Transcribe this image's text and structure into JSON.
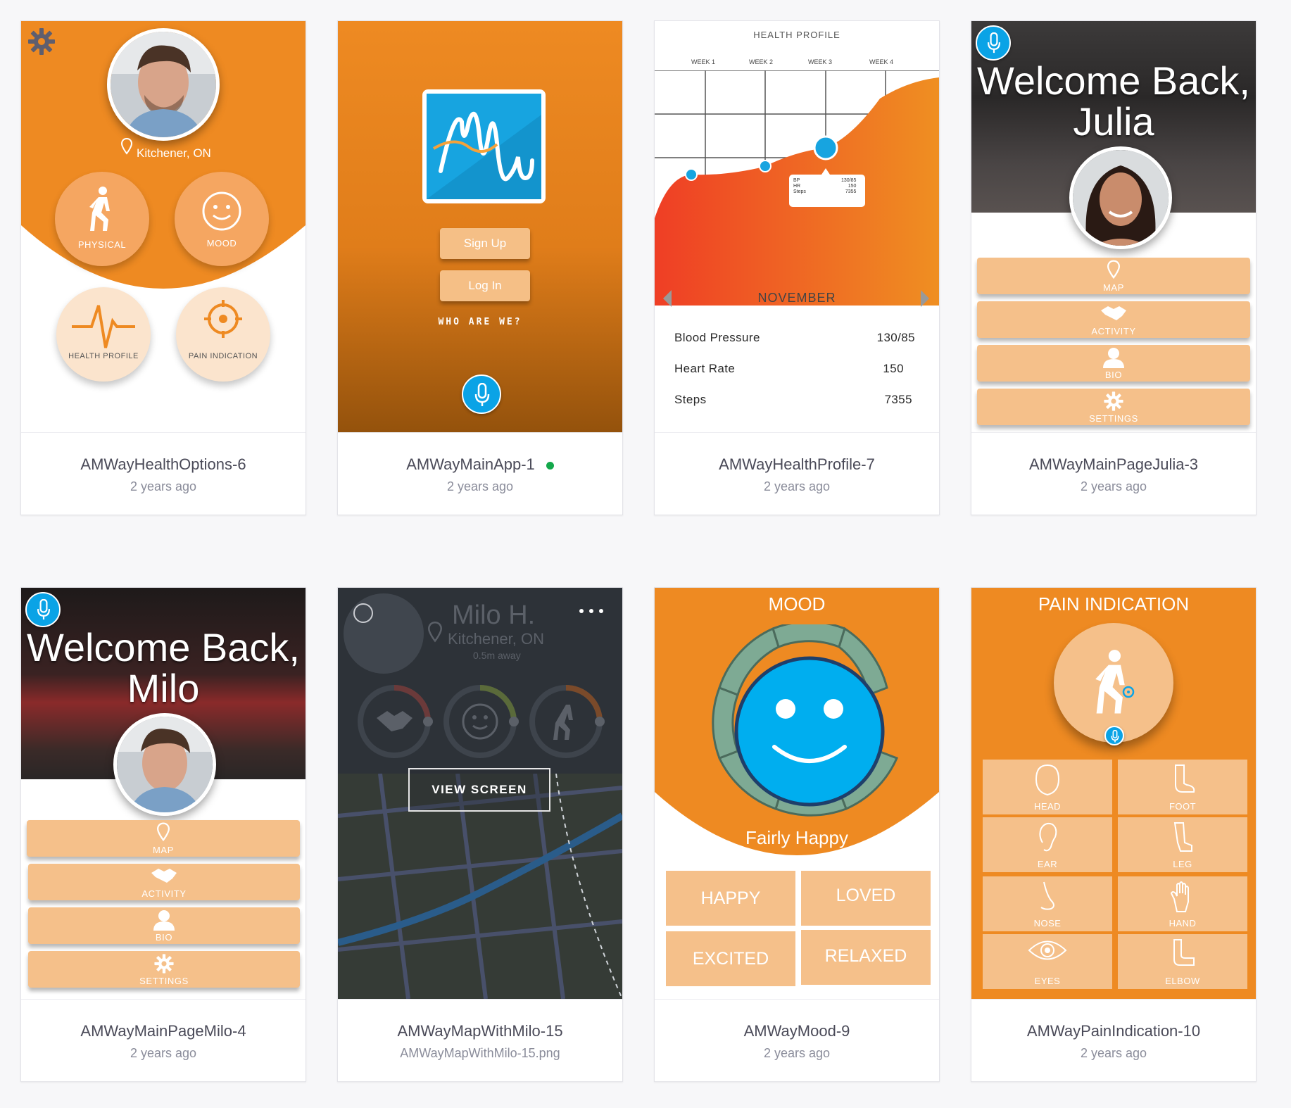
{
  "cards": [
    {
      "title": "AMWayHealthOptions-6",
      "subtitle": "2 years ago"
    },
    {
      "title": "AMWayMainApp-1",
      "subtitle": "2 years ago"
    },
    {
      "title": "AMWayHealthProfile-7",
      "subtitle": "2 years ago"
    },
    {
      "title": "AMWayMainPageJulia-3",
      "subtitle": "2 years ago"
    },
    {
      "title": "AMWayMainPageMilo-4",
      "subtitle": "2 years ago"
    },
    {
      "title": "AMWayMapWithMilo-15",
      "subtitle": "AMWayMapWithMilo-15.png"
    },
    {
      "title": "AMWayMood-9",
      "subtitle": "2 years ago"
    },
    {
      "title": "AMWayPainIndication-10",
      "subtitle": "2 years ago"
    }
  ],
  "health_options": {
    "location": "Kitchener, ON",
    "options": [
      "PHYSICAL",
      "MOOD",
      "HEALTH PROFILE",
      "PAIN INDICATION"
    ]
  },
  "main_app": {
    "sign_up": "Sign Up",
    "log_in": "Log In",
    "who_are_we": "WHO ARE WE?"
  },
  "health_profile": {
    "title": "HEALTH PROFILE",
    "weeks": [
      "WEEK 1",
      "WEEK 2",
      "WEEK 3",
      "WEEK 4"
    ],
    "month": "NOVEMBER",
    "tooltip": {
      "labels": "BP\nHR\nSteps",
      "values": "130/85\n150\n7355"
    },
    "rows": [
      {
        "label": "Blood Pressure",
        "value": "130/85"
      },
      {
        "label": "Heart Rate",
        "value": "150"
      },
      {
        "label": "Steps",
        "value": "7355"
      }
    ]
  },
  "julia_page": {
    "welcome_line1": "Welcome Back,",
    "welcome_line2": "Julia",
    "menu": [
      "MAP",
      "ACTIVITY",
      "BIO",
      "SETTINGS"
    ]
  },
  "milo_page": {
    "welcome_line1": "Welcome Back,",
    "welcome_line2": "Milo",
    "menu": [
      "MAP",
      "ACTIVITY",
      "BIO",
      "SETTINGS"
    ]
  },
  "map_page": {
    "name": "Milo H.",
    "location": "Kitchener, ON",
    "distance": "0.5m away",
    "view_screen": "VIEW SCREEN"
  },
  "mood_page": {
    "title": "MOOD",
    "status": "Fairly Happy",
    "options": [
      "HAPPY",
      "LOVED",
      "EXCITED",
      "RELAXED"
    ]
  },
  "pain_page": {
    "title": "PAIN INDICATION",
    "parts": [
      "HEAD",
      "FOOT",
      "EAR",
      "LEG",
      "NOSE",
      "HAND",
      "EYES",
      "ELBOW"
    ]
  },
  "colors": {
    "orange": "#ee8a22",
    "light_orange": "#f5c08a",
    "mic_blue": "#0aa3e6",
    "online_green": "#14a84b"
  }
}
